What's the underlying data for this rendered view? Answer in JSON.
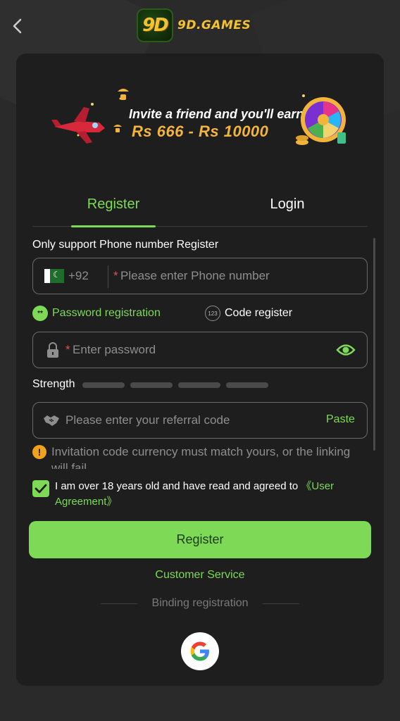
{
  "header": {
    "logo_badge": "9D",
    "logo_text": "9D.GAMES",
    "back_icon": "chevron-left-icon"
  },
  "banner": {
    "line1": "Invite a friend and you'll earn",
    "line2": "Rs 666 - Rs 10000"
  },
  "tabs": {
    "register": "Register",
    "login": "Login",
    "active": "register"
  },
  "form": {
    "section_title": "Only support Phone number Register",
    "phone": {
      "country_code": "+92",
      "flag_icon": "pakistan-flag-icon",
      "required_mark": "*",
      "placeholder": "Please enter Phone number",
      "value": ""
    },
    "modes": {
      "password": "Password registration",
      "code": "Code register",
      "password_icon": "**",
      "code_icon": "123",
      "selected": "password"
    },
    "password": {
      "required_mark": "*",
      "placeholder": "Enter password",
      "value": ""
    },
    "strength": {
      "label": "Strength",
      "levels": 4,
      "filled": 0
    },
    "referral": {
      "placeholder": "Please enter your referral code",
      "value": "",
      "paste_label": "Paste"
    },
    "warning": {
      "icon": "!",
      "text": "Invitation code currency must match yours, or the linking will fail"
    },
    "agreement": {
      "checked": true,
      "text": "I am over 18 years old and have read and agreed to ",
      "link": "《User Agreement》"
    },
    "register_button": "Register"
  },
  "footer": {
    "customer_service": "Customer Service",
    "binding_label": "Binding registration",
    "google_icon": "google-icon"
  },
  "colors": {
    "accent": "#7ed957",
    "card_bg": "#1e1e1e",
    "page_bg": "#2a2a2a",
    "banner_gold": "#f3b43c",
    "warning": "#f2a31a",
    "required": "#e45050"
  }
}
